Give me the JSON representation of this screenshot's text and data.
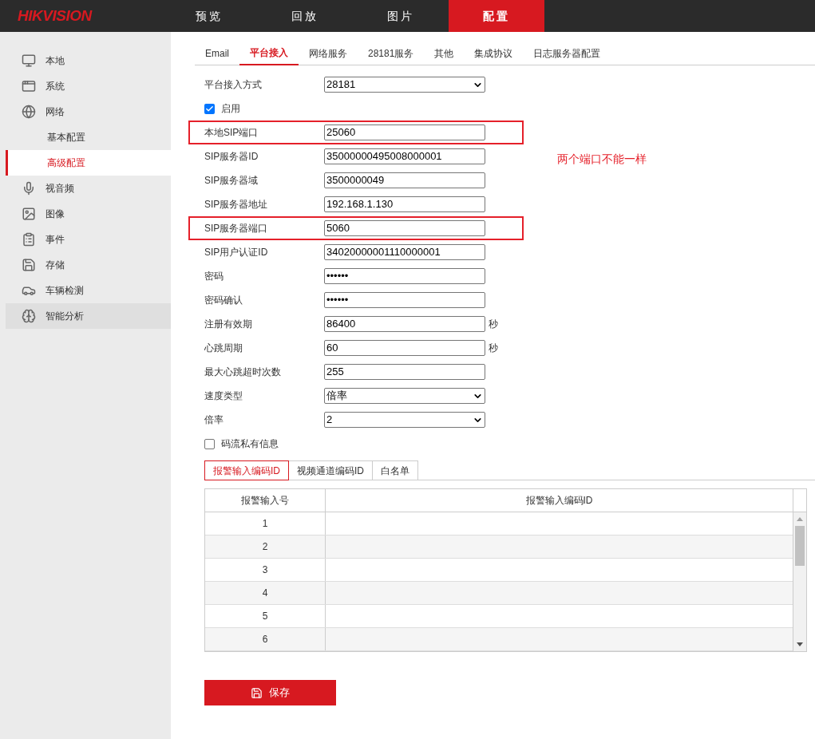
{
  "header": {
    "logo": "HIKVISION",
    "nav": [
      {
        "label": "预览",
        "selected": false
      },
      {
        "label": "回放",
        "selected": false
      },
      {
        "label": "图片",
        "selected": false
      },
      {
        "label": "配置",
        "selected": true
      }
    ]
  },
  "sidebar": {
    "items": [
      {
        "label": "本地",
        "selected": false,
        "hovered": false
      },
      {
        "label": "系统",
        "selected": false,
        "hovered": false
      },
      {
        "label": "网络",
        "selected": false,
        "hovered": false,
        "children": [
          {
            "label": "基本配置",
            "selected": false
          },
          {
            "label": "高级配置",
            "selected": true
          }
        ]
      },
      {
        "label": "视音频",
        "selected": false,
        "hovered": false
      },
      {
        "label": "图像",
        "selected": false,
        "hovered": false
      },
      {
        "label": "事件",
        "selected": false,
        "hovered": false
      },
      {
        "label": "存储",
        "selected": false,
        "hovered": false
      },
      {
        "label": "车辆检测",
        "selected": false,
        "hovered": false
      },
      {
        "label": "智能分析",
        "selected": false,
        "hovered": true
      }
    ]
  },
  "tabs": [
    {
      "label": "Email",
      "selected": false
    },
    {
      "label": "平台接入",
      "selected": true
    },
    {
      "label": "网络服务",
      "selected": false
    },
    {
      "label": "28181服务",
      "selected": false
    },
    {
      "label": "其他",
      "selected": false
    },
    {
      "label": "集成协议",
      "selected": false
    },
    {
      "label": "日志服务器配置",
      "selected": false
    }
  ],
  "form": [
    {
      "kind": "select",
      "label": "平台接入方式",
      "value": "28181",
      "highlighted": false
    },
    {
      "kind": "checkbox",
      "label": "启用",
      "checked": true
    },
    {
      "kind": "text",
      "label": "本地SIP端口",
      "value": "25060",
      "highlighted": true
    },
    {
      "kind": "text",
      "label": "SIP服务器ID",
      "value": "35000000495008000001",
      "highlighted": false
    },
    {
      "kind": "text",
      "label": "SIP服务器域",
      "value": "3500000049",
      "highlighted": false
    },
    {
      "kind": "text",
      "label": "SIP服务器地址",
      "value": "192.168.1.130",
      "highlighted": false
    },
    {
      "kind": "text",
      "label": "SIP服务器端口",
      "value": "5060",
      "highlighted": true
    },
    {
      "kind": "text",
      "label": "SIP用户认证ID",
      "value": "34020000001110000001",
      "highlighted": false
    },
    {
      "kind": "text",
      "label": "密码",
      "value": "••••••",
      "highlighted": false
    },
    {
      "kind": "text",
      "label": "密码确认",
      "value": "••••••",
      "highlighted": false
    },
    {
      "kind": "text",
      "label": "注册有效期",
      "value": "86400",
      "unit": "秒",
      "highlighted": false
    },
    {
      "kind": "text",
      "label": "心跳周期",
      "value": "60",
      "unit": "秒",
      "highlighted": false
    },
    {
      "kind": "text",
      "label": "最大心跳超时次数",
      "value": "255",
      "highlighted": false
    },
    {
      "kind": "select",
      "label": "速度类型",
      "value": "倍率",
      "highlighted": false
    },
    {
      "kind": "select",
      "label": "倍率",
      "value": "2",
      "highlighted": false
    },
    {
      "kind": "checkbox",
      "label": "码流私有信息",
      "checked": false
    }
  ],
  "note": "两个端口不能一样",
  "sub_tabs": [
    {
      "label": "报警输入编码ID",
      "selected": true
    },
    {
      "label": "视频通道编码ID",
      "selected": false
    },
    {
      "label": "白名单",
      "selected": false
    }
  ],
  "table": {
    "columns": [
      "报警输入号",
      "报警输入编码ID"
    ],
    "rows": [
      [
        "1",
        ""
      ],
      [
        "2",
        ""
      ],
      [
        "3",
        ""
      ],
      [
        "4",
        ""
      ],
      [
        "5",
        ""
      ],
      [
        "6",
        ""
      ]
    ]
  },
  "save_button": "保存"
}
